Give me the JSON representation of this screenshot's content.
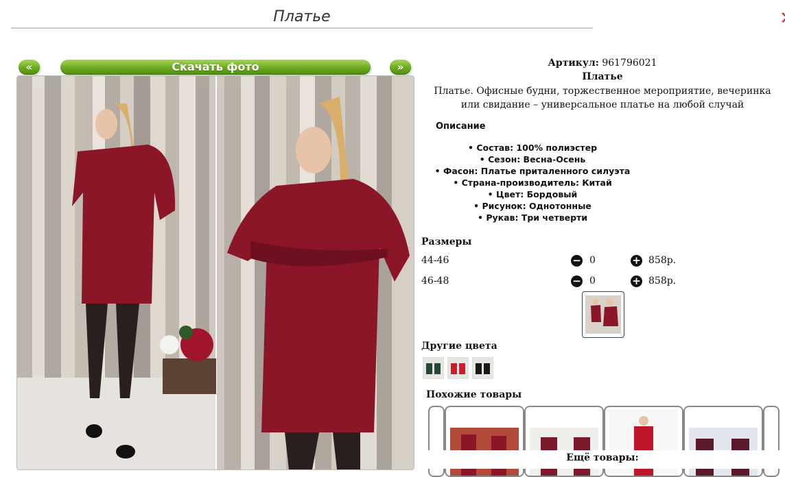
{
  "page": {
    "title": "Платье",
    "close_glyph": "✕"
  },
  "gallery": {
    "prev_label": "«",
    "download_label": "Скачать фото",
    "next_label": "»"
  },
  "product": {
    "article_label": "Артикул:",
    "article_value": "961796021",
    "name": "Платье",
    "description": "Платье. Офисные будни, торжественное мероприятие, вечеринка или свидание – универсальное платье на любой случай",
    "description_heading": "Описание",
    "specs": [
      "Состав: 100% полиэстер",
      "Сезон: Весна-Осень",
      "Фасон: Платье приталенного силуэта",
      "Страна-производитель: Китай",
      "Цвет: Бордовый",
      "Рисунок: Однотонные",
      "Рукав: Три четверти"
    ]
  },
  "sizes": {
    "heading": "Размеры",
    "minus_glyph": "−",
    "plus_glyph": "+",
    "rows": [
      {
        "size": "44-46",
        "qty": "0",
        "price": "858р."
      },
      {
        "size": "46-48",
        "qty": "0",
        "price": "858р."
      }
    ]
  },
  "other_colors": {
    "heading": "Другие цвета",
    "items": [
      "green-dress-thumb",
      "red-dress-thumb",
      "black-dress-thumb"
    ]
  },
  "similar": {
    "heading": "Похожие товары",
    "more_label": "Ещё товары:"
  },
  "colors": {
    "accent_green": "#6aaa1c",
    "dress_burgundy": "#8a1628",
    "wood_wall": "#cfc8c0"
  }
}
